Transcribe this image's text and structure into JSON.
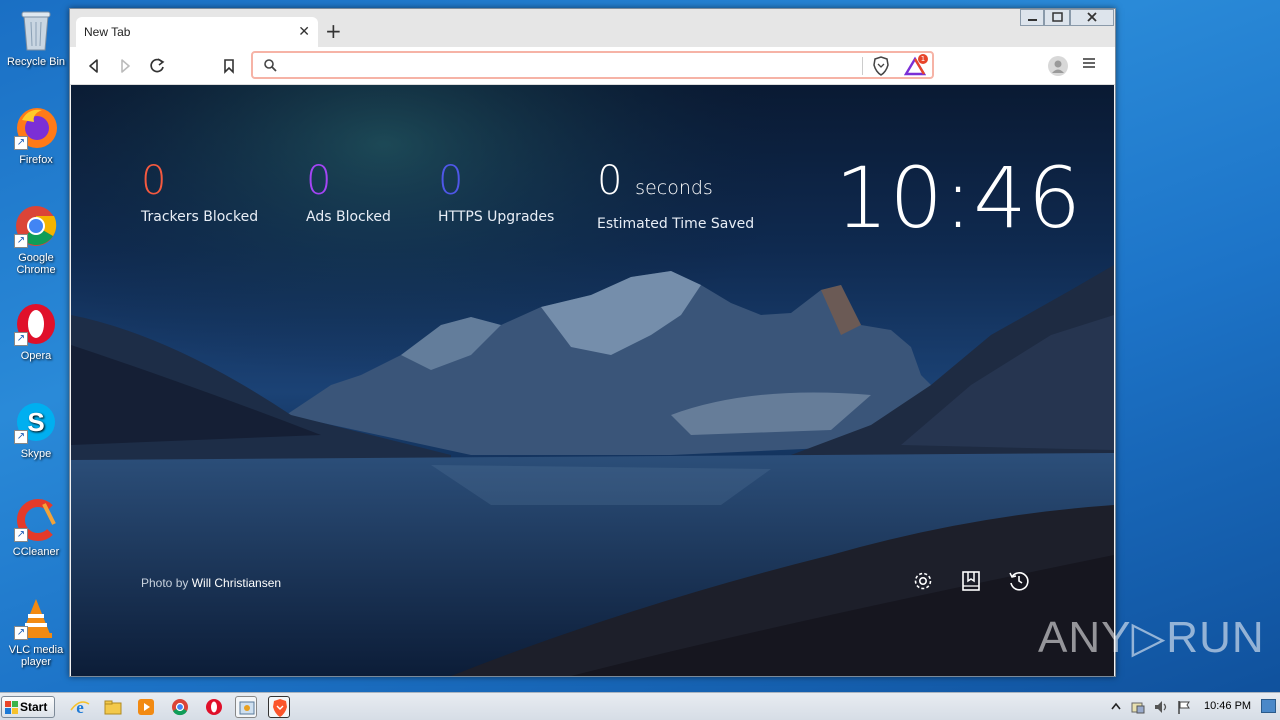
{
  "desktop": {
    "icons": [
      {
        "label": "Recycle Bin",
        "icon": "recycle-bin-icon"
      },
      {
        "label": "Firefox",
        "icon": "firefox-icon"
      },
      {
        "label": "Google Chrome",
        "icon": "chrome-icon"
      },
      {
        "label": "Opera",
        "icon": "opera-icon"
      },
      {
        "label": "Skype",
        "icon": "skype-icon"
      },
      {
        "label": "CCleaner",
        "icon": "ccleaner-icon"
      },
      {
        "label": "VLC media player",
        "icon": "vlc-icon"
      }
    ]
  },
  "browser": {
    "tab_title": "New Tab",
    "tab_close": "✕",
    "new_tab": "+",
    "address_value": "",
    "rewards_badge": "1"
  },
  "ntp": {
    "stats": [
      {
        "value": "0",
        "label": "Trackers Blocked",
        "color": "#f5593f"
      },
      {
        "value": "0",
        "label": "Ads Blocked",
        "color": "#a445f5"
      },
      {
        "value": "0",
        "label": "HTTPS Upgrades",
        "color": "#4f57e8"
      }
    ],
    "time_saved": {
      "value": "0",
      "unit": "seconds",
      "label": "Estimated Time Saved"
    },
    "clock": "10:46",
    "credit_prefix": "Photo by",
    "credit_author": "Will Christiansen"
  },
  "taskbar": {
    "start_label": "Start",
    "clock": "10:46 PM"
  },
  "watermark": "ANY▷RUN"
}
